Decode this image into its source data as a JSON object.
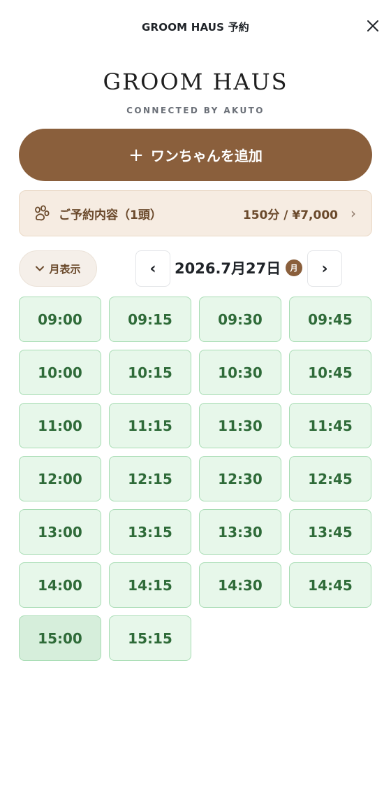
{
  "header": {
    "title": "GROOM HAUS 予約"
  },
  "brand": {
    "name": "GROOM HAUS",
    "tagline": "CONNECTED BY AKUTO"
  },
  "add_dog_button": {
    "plus": "+",
    "label": "ワンちゃんを追加"
  },
  "summary": {
    "label": "ご予約内容（1頭）",
    "value": "150分 / ¥7,000",
    "chevron": "›"
  },
  "calendar": {
    "month_view_label": "月表示",
    "month_view_chevron": "⌄",
    "prev": "‹",
    "next": "›",
    "date": "2026.7月27日",
    "weekday": "月"
  },
  "slots": [
    "09:00",
    "09:15",
    "09:30",
    "09:45",
    "10:00",
    "10:15",
    "10:30",
    "10:45",
    "11:00",
    "11:15",
    "11:30",
    "11:45",
    "12:00",
    "12:15",
    "12:30",
    "12:45",
    "13:00",
    "13:15",
    "13:30",
    "13:45",
    "14:00",
    "14:15",
    "14:30",
    "14:45",
    "15:00",
    "15:15"
  ],
  "colors": {
    "accent_brown": "#8a5f3c",
    "summary_bg": "#f6ece2",
    "slot_bg": "#e7f7ea",
    "slot_text": "#2f6b39"
  }
}
